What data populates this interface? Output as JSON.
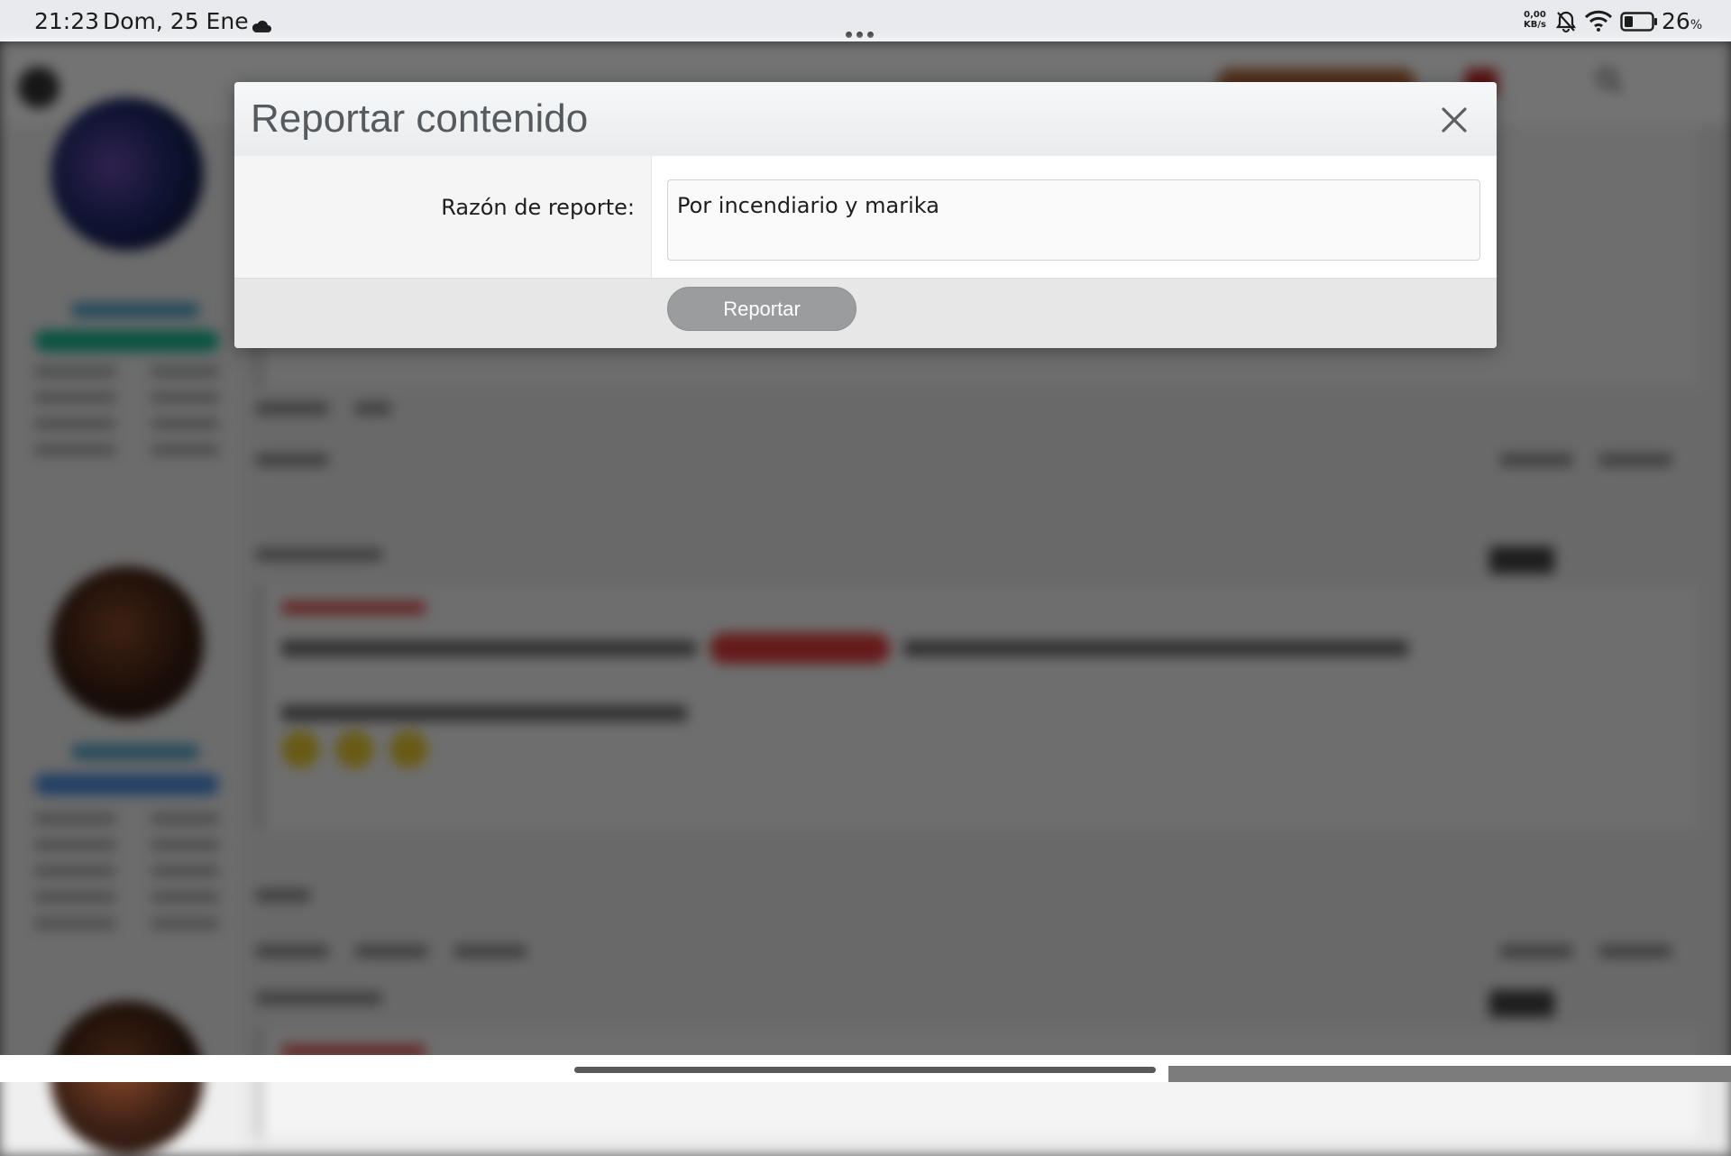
{
  "status_bar": {
    "time": "21:23",
    "date": "Dom, 25 Ene",
    "net_speed_value": "0,00",
    "net_speed_unit": "KB/s",
    "battery_level": "26",
    "battery_unit": "%",
    "icons": [
      "cloud-icon",
      "more-icon",
      "bell-muted-icon",
      "wifi-icon",
      "battery-icon"
    ]
  },
  "modal": {
    "title": "Reportar contenido",
    "reason_label": "Razón de reporte:",
    "reason_value": "Por incendiario y marika",
    "submit_label": "Reportar",
    "close_icon": "close-icon"
  },
  "colors": {
    "header_gradient_top": "#f7f8f9",
    "header_gradient_bottom": "#e9ebec",
    "label_cell_bg": "#f5f5f5",
    "footer_bg": "#e7e7e8",
    "submit_bg": "#9a9c9d",
    "backdrop": "#5e5e5e"
  }
}
